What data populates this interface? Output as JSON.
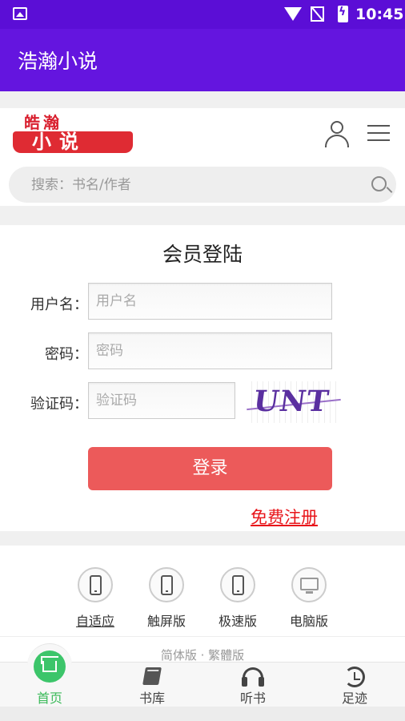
{
  "status_bar": {
    "time": "10:45"
  },
  "app_bar": {
    "title": "浩瀚小说"
  },
  "header": {
    "logo_top": "皓瀚",
    "logo_bottom": "小说",
    "search_placeholder": "搜索：书名/作者"
  },
  "login": {
    "title": "会员登陆",
    "username_label": "用户名：",
    "username_placeholder": "用户名",
    "password_label": "密码：",
    "password_placeholder": "密码",
    "captcha_label": "验证码：",
    "captcha_placeholder": "验证码",
    "captcha_text": "UNT I",
    "submit_label": "登录",
    "register_label": "免费注册"
  },
  "versions": {
    "items": [
      {
        "label": "自适应",
        "icon": "phone-icon"
      },
      {
        "label": "触屏版",
        "icon": "phone-icon"
      },
      {
        "label": "极速版",
        "icon": "phone-icon"
      },
      {
        "label": "电脑版",
        "icon": "monitor-icon"
      }
    ],
    "language": "简体版 · 繁體版"
  },
  "bottom_nav": {
    "items": [
      {
        "label": "首页",
        "icon": "home-icon",
        "active": true
      },
      {
        "label": "书库",
        "icon": "book-icon"
      },
      {
        "label": "听书",
        "icon": "headphones-icon"
      },
      {
        "label": "足迹",
        "icon": "history-icon"
      }
    ],
    "accent": "#3cc56a"
  },
  "colors": {
    "app_bar": "#6415df",
    "login_button": "#ec5a5a",
    "register_link": "#e8141a"
  }
}
